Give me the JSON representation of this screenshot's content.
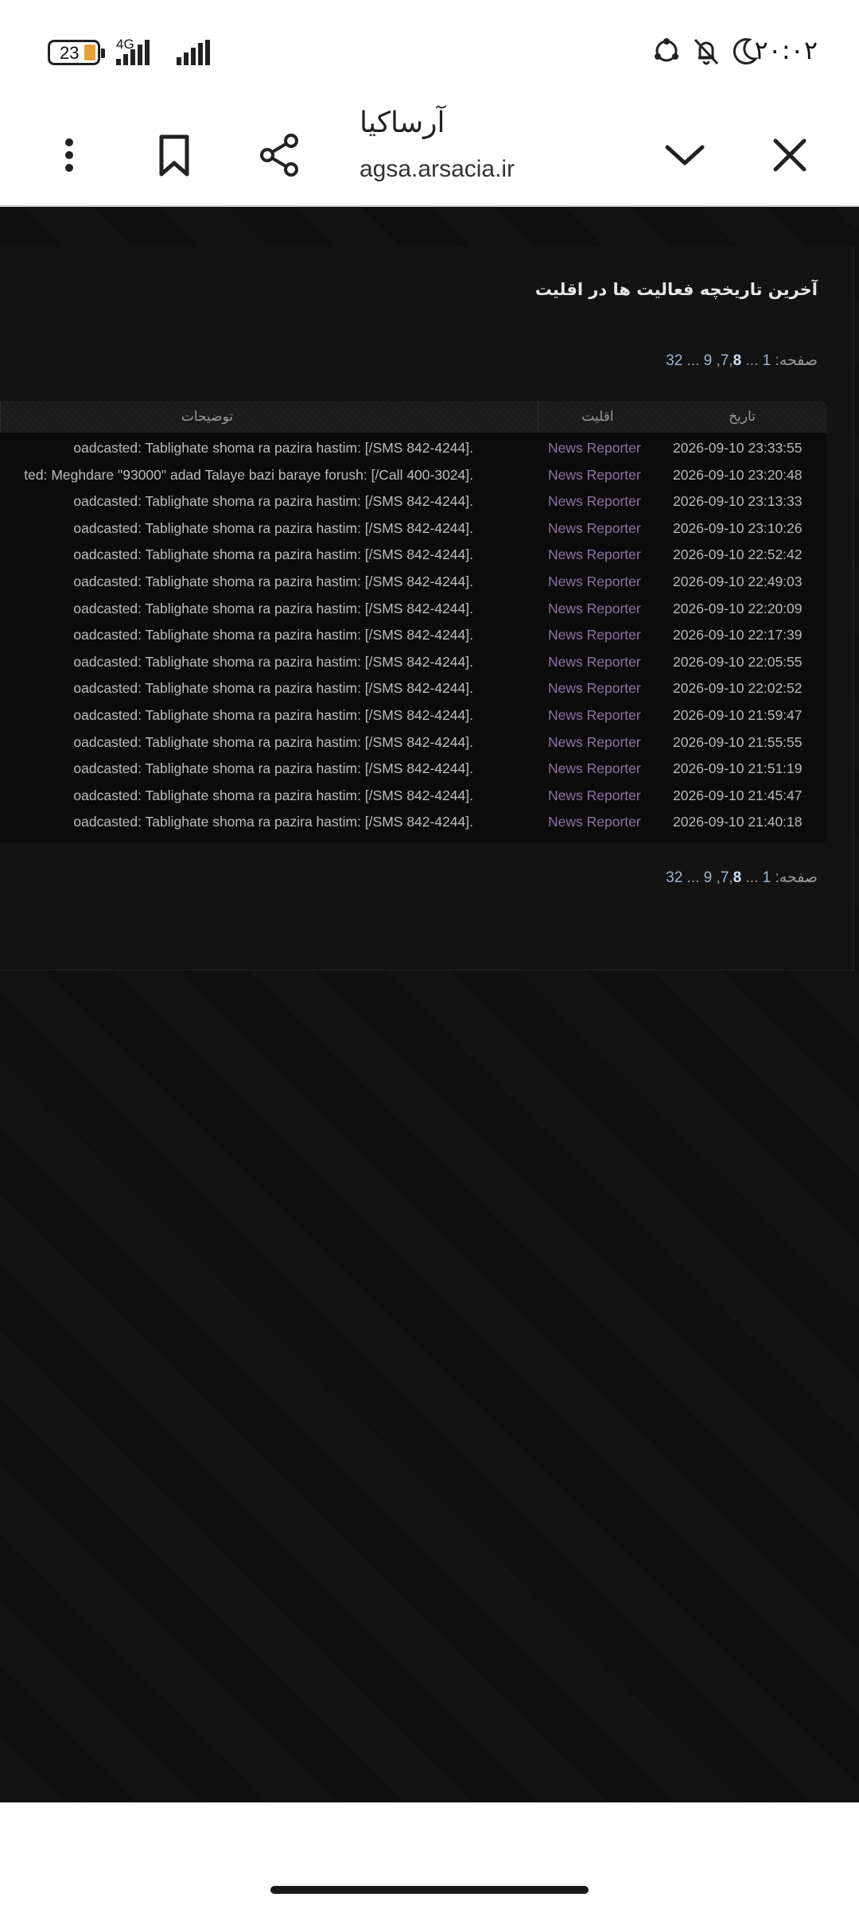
{
  "status_bar": {
    "battery": "23",
    "network": "4G",
    "time": "۲۰:۰۲",
    "icons": [
      "signal-icon",
      "signal-icon",
      "moon-icon",
      "bell-off-icon",
      "sync-icon"
    ]
  },
  "browser": {
    "site_title": "آرساکیا",
    "site_url": "agsa.arsacia.ir",
    "icons": [
      "more-vertical-icon",
      "bookmark-icon",
      "share-icon",
      "chevron-down-icon",
      "close-icon"
    ]
  },
  "page": {
    "title": "آخرین تاریخچه فعالیت ها در اقلیت",
    "pager": {
      "label": "صفحه:",
      "first": "1",
      "ellipsis1": "...",
      "p7": "7",
      "comma1": ",",
      "p8": "8",
      "comma2": ",",
      "p9": "9",
      "ellipsis2": "...",
      "last": "32"
    },
    "table": {
      "headers": {
        "date": "تاریخ",
        "minority": "اقلیت",
        "desc": "توضیحات"
      },
      "rows": [
        {
          "date": "2026-09-10 23:33:55",
          "type": "News Reporter",
          "desc": "oadcasted: Tablighate shoma ra pazira hastim: [/SMS 842-4244]."
        },
        {
          "date": "2026-09-10 23:20:48",
          "type": "News Reporter",
          "desc": "ted: Meghdare \"93000\" adad Talaye bazi baraye forush: [/Call 400-3024]."
        },
        {
          "date": "2026-09-10 23:13:33",
          "type": "News Reporter",
          "desc": "oadcasted: Tablighate shoma ra pazira hastim: [/SMS 842-4244]."
        },
        {
          "date": "2026-09-10 23:10:26",
          "type": "News Reporter",
          "desc": "oadcasted: Tablighate shoma ra pazira hastim: [/SMS 842-4244]."
        },
        {
          "date": "2026-09-10 22:52:42",
          "type": "News Reporter",
          "desc": "oadcasted: Tablighate shoma ra pazira hastim: [/SMS 842-4244]."
        },
        {
          "date": "2026-09-10 22:49:03",
          "type": "News Reporter",
          "desc": "oadcasted: Tablighate shoma ra pazira hastim: [/SMS 842-4244]."
        },
        {
          "date": "2026-09-10 22:20:09",
          "type": "News Reporter",
          "desc": "oadcasted: Tablighate shoma ra pazira hastim: [/SMS 842-4244]."
        },
        {
          "date": "2026-09-10 22:17:39",
          "type": "News Reporter",
          "desc": "oadcasted: Tablighate shoma ra pazira hastim: [/SMS 842-4244]."
        },
        {
          "date": "2026-09-10 22:05:55",
          "type": "News Reporter",
          "desc": "oadcasted: Tablighate shoma ra pazira hastim: [/SMS 842-4244]."
        },
        {
          "date": "2026-09-10 22:02:52",
          "type": "News Reporter",
          "desc": "oadcasted: Tablighate shoma ra pazira hastim: [/SMS 842-4244]."
        },
        {
          "date": "2026-09-10 21:59:47",
          "type": "News Reporter",
          "desc": "oadcasted: Tablighate shoma ra pazira hastim: [/SMS 842-4244]."
        },
        {
          "date": "2026-09-10 21:55:55",
          "type": "News Reporter",
          "desc": "oadcasted: Tablighate shoma ra pazira hastim: [/SMS 842-4244]."
        },
        {
          "date": "2026-09-10 21:51:19",
          "type": "News Reporter",
          "desc": "oadcasted: Tablighate shoma ra pazira hastim: [/SMS 842-4244]."
        },
        {
          "date": "2026-09-10 21:45:47",
          "type": "News Reporter",
          "desc": "oadcasted: Tablighate shoma ra pazira hastim: [/SMS 842-4244]."
        },
        {
          "date": "2026-09-10 21:40:18",
          "type": "News Reporter",
          "desc": "oadcasted: Tablighate shoma ra pazira hastim: [/SMS 842-4244]."
        }
      ]
    }
  },
  "colors": {
    "page_bg": "#101010",
    "reporter_link": "#8e72a6",
    "pager_link": "#9eb6cf",
    "battery_fill": "#e8a13a"
  }
}
